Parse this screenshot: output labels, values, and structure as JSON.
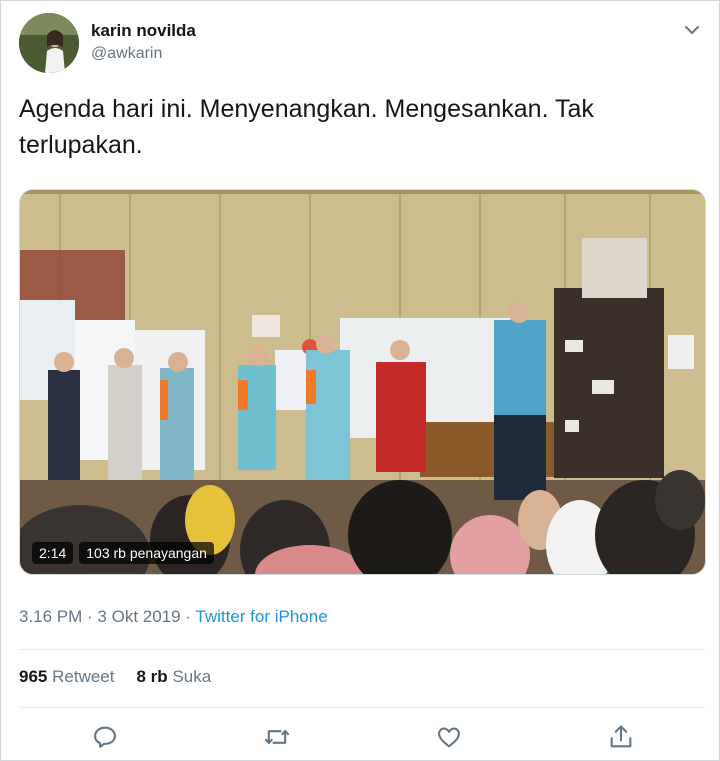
{
  "user": {
    "display_name": "karin novilda",
    "handle": "@awkarin",
    "avatar_icon": "avatar"
  },
  "tweet": {
    "text": "Agenda hari ini. Menyenangkan. Mengesankan. Tak terlupakan."
  },
  "video": {
    "duration": "2:14",
    "views": "103 rb penayangan"
  },
  "meta": {
    "time_date": "3.16 PM · 3 Okt 2019 · ",
    "source": "Twitter for iPhone"
  },
  "stats": {
    "retweets_count": "965",
    "retweets_label": "Retweet",
    "likes_count": "8 rb",
    "likes_label": "Suka"
  },
  "actions": {
    "reply_icon": "reply-icon",
    "retweet_icon": "retweet-icon",
    "like_icon": "heart-icon",
    "share_icon": "share-icon"
  },
  "colors": {
    "link": "#1b95e0",
    "secondary_text": "#657786",
    "icon": "#657786"
  }
}
